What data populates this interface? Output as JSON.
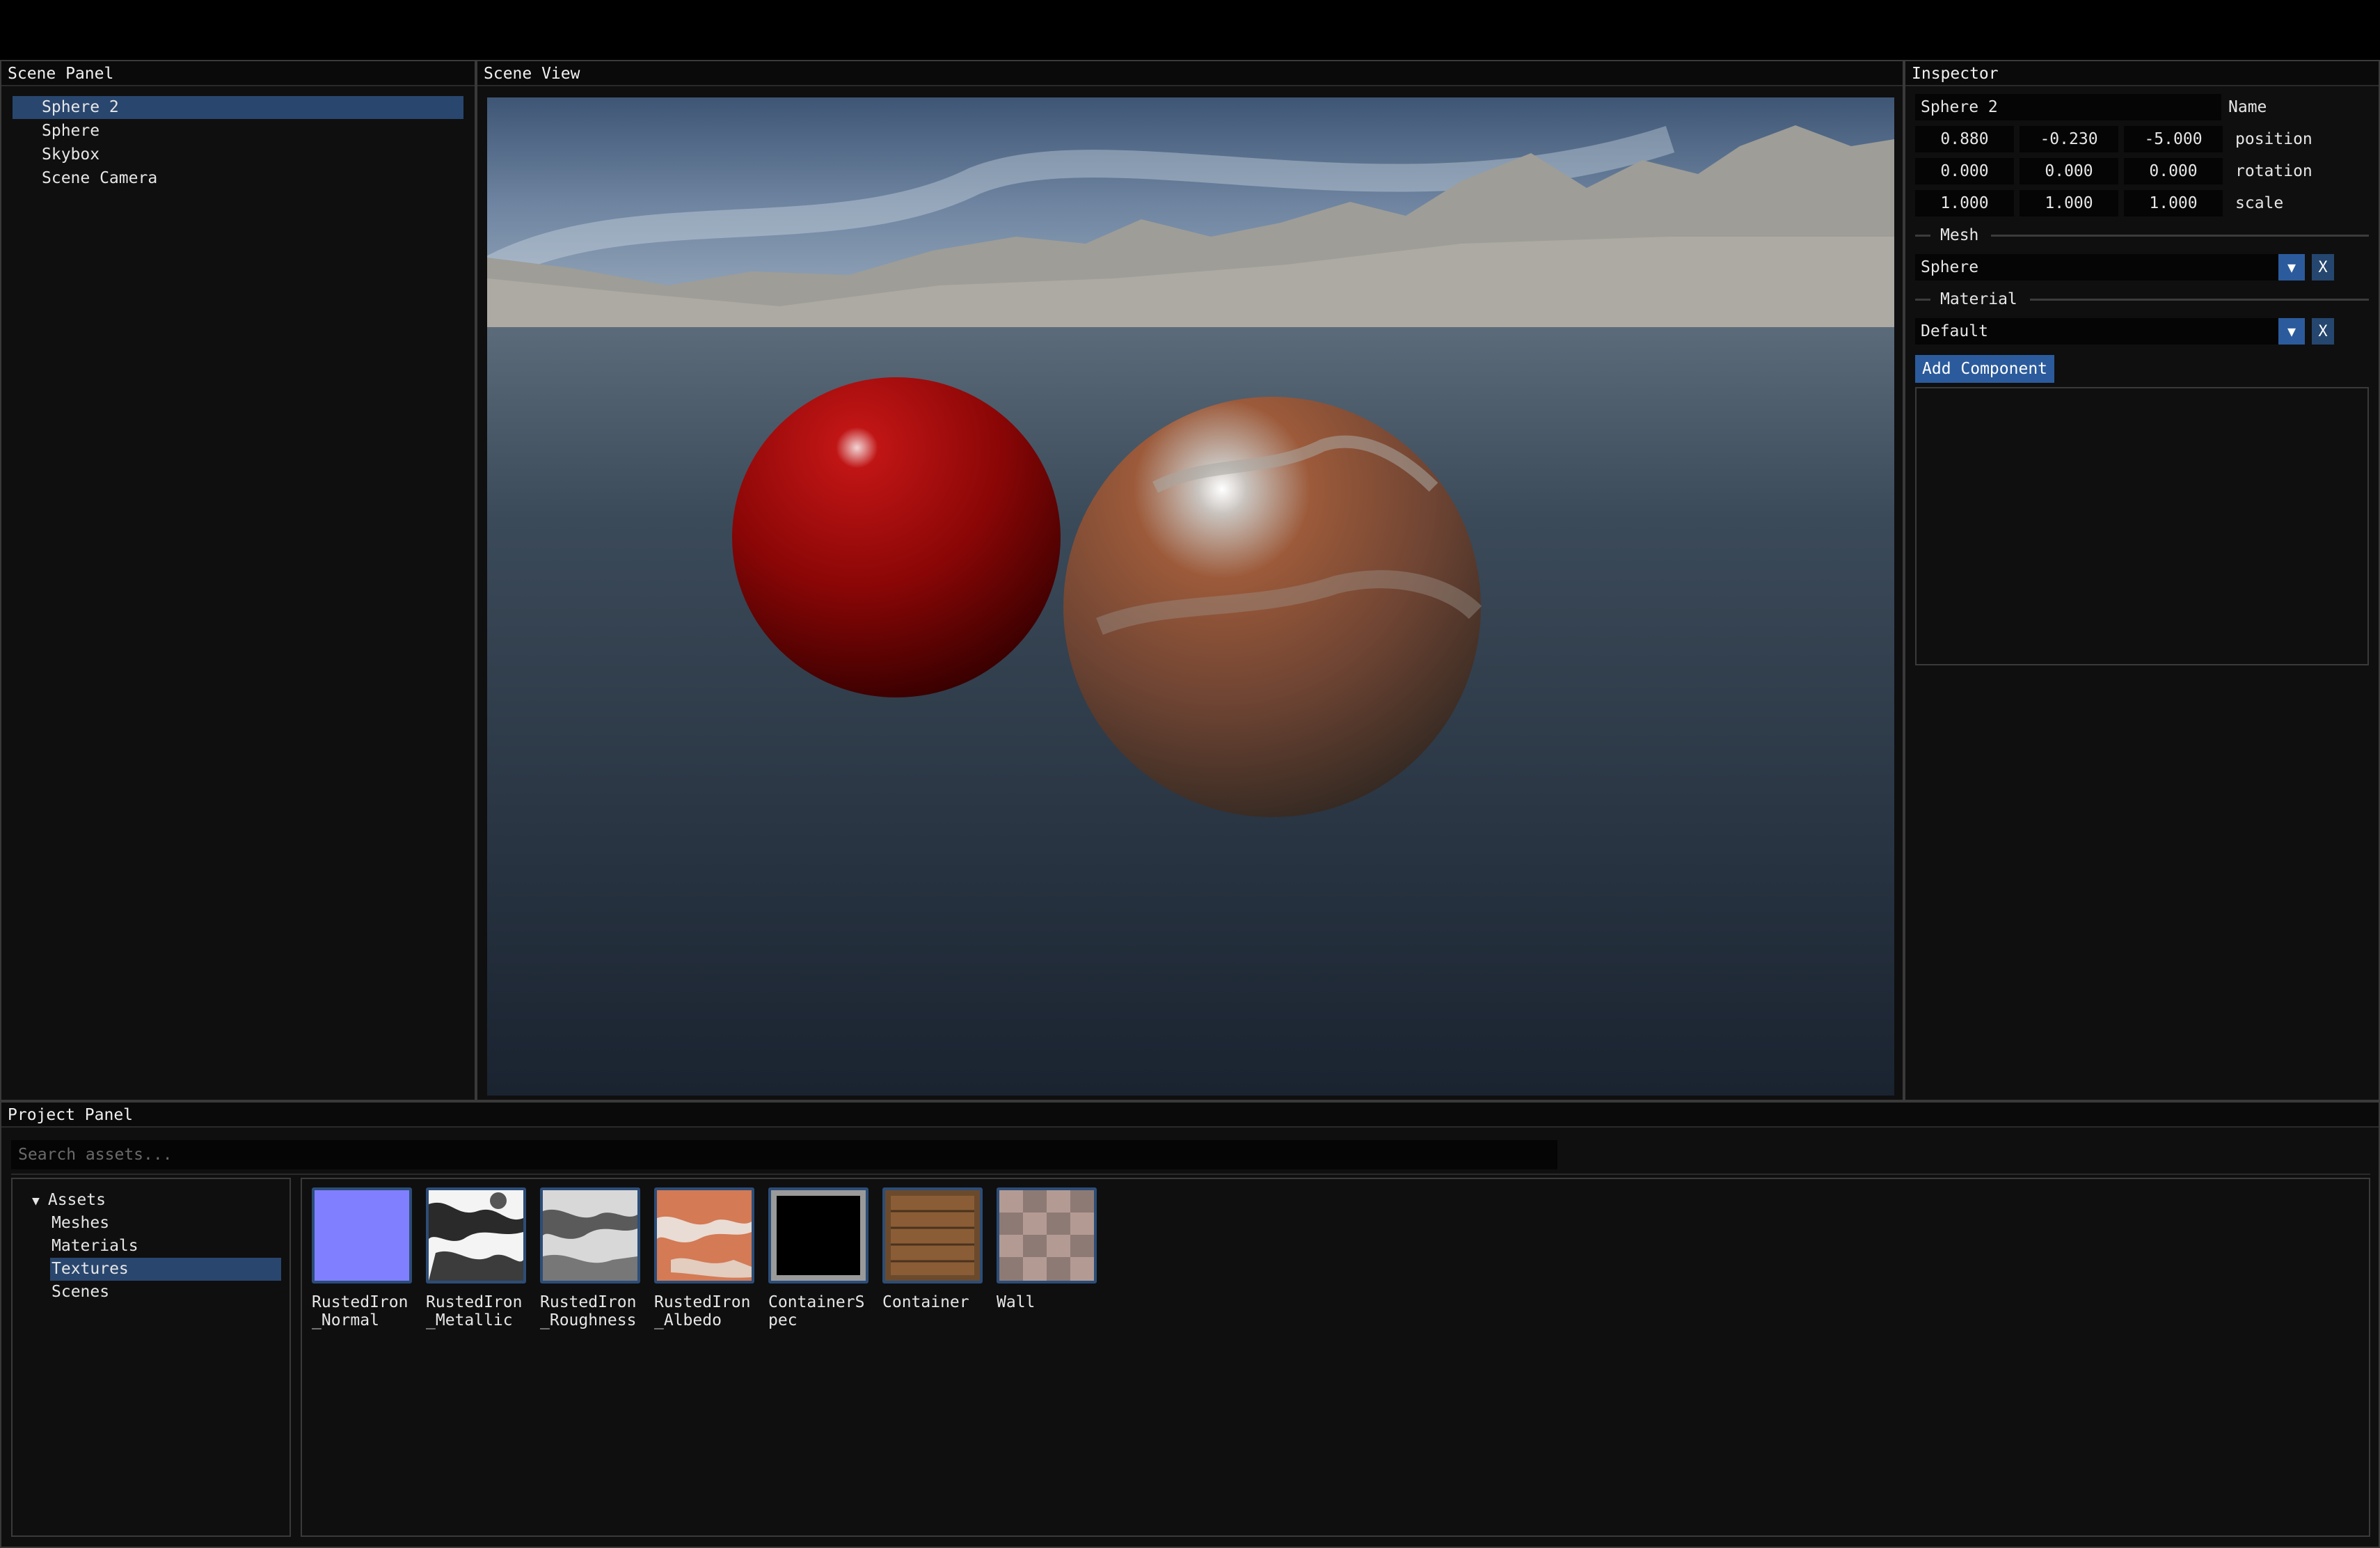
{
  "scene_panel": {
    "title": "Scene Panel",
    "items": [
      {
        "label": "Sphere 2",
        "selected": true
      },
      {
        "label": "Sphere",
        "selected": false
      },
      {
        "label": "Skybox",
        "selected": false
      },
      {
        "label": "Scene Camera",
        "selected": false
      }
    ]
  },
  "scene_view": {
    "title": "Scene View"
  },
  "inspector": {
    "title": "Inspector",
    "name_value": "Sphere 2",
    "name_label": "Name",
    "position": {
      "x": "0.880",
      "y": "-0.230",
      "z": "-5.000",
      "label": "position"
    },
    "rotation": {
      "x": "0.000",
      "y": "0.000",
      "z": "0.000",
      "label": "rotation"
    },
    "scale": {
      "x": "1.000",
      "y": "1.000",
      "z": "1.000",
      "label": "scale"
    },
    "mesh_header": "Mesh",
    "mesh_value": "Sphere",
    "material_header": "Material",
    "material_value": "Default",
    "remove_label": "X",
    "add_component_label": "Add Component"
  },
  "project_panel": {
    "title": "Project Panel",
    "search_placeholder": "Search assets...",
    "folders": {
      "root": "Assets",
      "root_icon": "triangle-down-icon",
      "children": [
        {
          "label": "Meshes",
          "selected": false
        },
        {
          "label": "Materials",
          "selected": false
        },
        {
          "label": "Textures",
          "selected": true
        },
        {
          "label": "Scenes",
          "selected": false
        }
      ]
    },
    "assets": [
      {
        "label": "RustedIron_Normal"
      },
      {
        "label": "RustedIron_Metallic"
      },
      {
        "label": "RustedIron_Roughness"
      },
      {
        "label": "RustedIron_Albedo"
      },
      {
        "label": "ContainerSpec"
      },
      {
        "label": "Container"
      },
      {
        "label": "Wall"
      }
    ]
  },
  "colors": {
    "accent": "#2b5b9c",
    "selection": "#29466e",
    "panel_bg": "#0f0f0f"
  }
}
